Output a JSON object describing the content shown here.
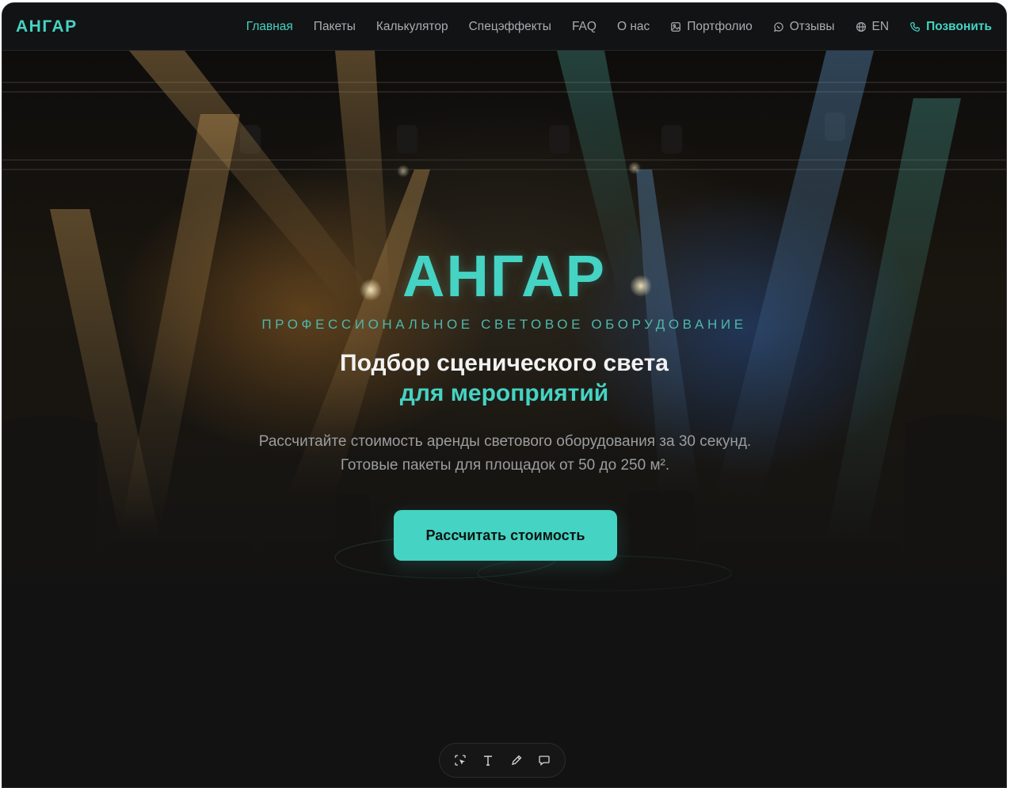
{
  "header": {
    "logo": "АНГАР",
    "nav": [
      {
        "label": "Главная",
        "active": true
      },
      {
        "label": "Пакеты"
      },
      {
        "label": "Калькулятор"
      },
      {
        "label": "Спецэффекты"
      },
      {
        "label": "FAQ"
      },
      {
        "label": "О нас"
      },
      {
        "label": "Портфолио",
        "icon": "image-icon"
      },
      {
        "label": "Отзывы",
        "icon": "chat-icon"
      },
      {
        "label": "EN",
        "icon": "globe-icon"
      },
      {
        "label": "Позвонить",
        "icon": "phone-icon"
      }
    ]
  },
  "hero": {
    "title": "АНГАР",
    "tagline": "ПРОФЕССИОНАЛЬНОЕ СВЕТОВОЕ ОБОРУДОВАНИЕ",
    "heading": "Подбор сценического света",
    "heading_accent": "для мероприятий",
    "description": "Рассчитайте стоимость аренды светового оборудования за 30 секунд. Готовые пакеты для площадок от 50 до 250 м².",
    "cta_label": "Рассчитать стоимость"
  },
  "toolbar": {
    "tools": [
      "select-icon",
      "text-icon",
      "pen-icon",
      "comment-icon"
    ]
  },
  "colors": {
    "accent": "#45d3c3",
    "background": "#121212",
    "nav_text": "#a9acaf"
  }
}
